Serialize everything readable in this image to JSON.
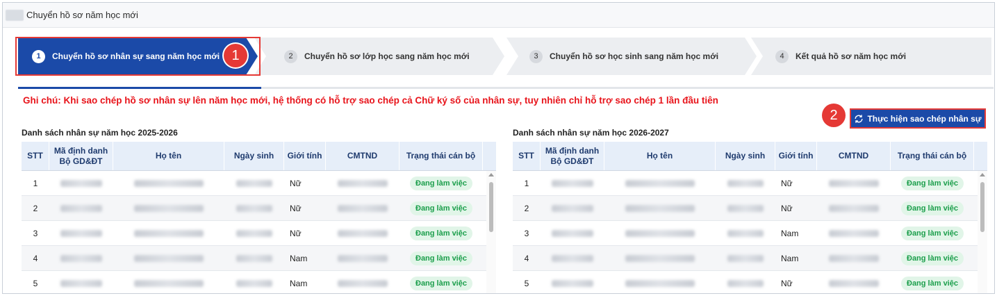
{
  "window": {
    "title": "Chuyển hồ sơ năm học mới"
  },
  "steps": [
    {
      "num": "1",
      "label": "Chuyển hồ sơ nhân sự sang năm học mới",
      "active": true
    },
    {
      "num": "2",
      "label": "Chuyển hồ sơ lớp học sang năm học mới",
      "active": false
    },
    {
      "num": "3",
      "label": "Chuyển hồ sơ học sinh sang năm học mới",
      "active": false
    },
    {
      "num": "4",
      "label": "Kết quả hồ sơ năm học mới",
      "active": false
    }
  ],
  "callouts": {
    "one": "1",
    "two": "2"
  },
  "note": "Ghi chú: Khi sao chép hồ sơ nhân sự lên năm học mới, hệ thống có hỗ trợ sao chép cả Chữ ký số của nhân sự, tuy nhiên chỉ hỗ trợ sao chép 1 lần đầu tiên",
  "copy_button": {
    "label": "Thực hiện sao chép nhân sự",
    "icon": "refresh-icon"
  },
  "columns": [
    "STT",
    "Mã định danh Bộ GD&ĐT",
    "Họ tên",
    "Ngày sinh",
    "Giới tính",
    "CMTND",
    "Trạng thái cán bộ"
  ],
  "left_table": {
    "caption": "Danh sách nhân sự năm học 2025-2026",
    "rows": [
      {
        "stt": "1",
        "gender": "Nữ",
        "status": "Đang làm việc"
      },
      {
        "stt": "2",
        "gender": "Nữ",
        "status": "Đang làm việc"
      },
      {
        "stt": "3",
        "gender": "Nữ",
        "status": "Đang làm việc"
      },
      {
        "stt": "4",
        "gender": "Nam",
        "status": "Đang làm việc"
      },
      {
        "stt": "5",
        "gender": "Nam",
        "status": "Đang làm việc"
      }
    ]
  },
  "right_table": {
    "caption": "Danh sách nhân sự năm học 2026-2027",
    "rows": [
      {
        "stt": "1",
        "gender": "Nữ",
        "status": "Đang làm việc"
      },
      {
        "stt": "2",
        "gender": "Nữ",
        "status": "Đang làm việc"
      },
      {
        "stt": "3",
        "gender": "Nam",
        "status": "Đang làm việc"
      },
      {
        "stt": "4",
        "gender": "Nam",
        "status": "Đang làm việc"
      },
      {
        "stt": "5",
        "gender": "Nữ",
        "status": "Đang làm việc"
      }
    ]
  },
  "colors": {
    "primary": "#1b4aa8",
    "accent": "#e53935",
    "note": "#e8141b",
    "status_bg": "#e1f5e8",
    "status_fg": "#1b9e4b"
  }
}
